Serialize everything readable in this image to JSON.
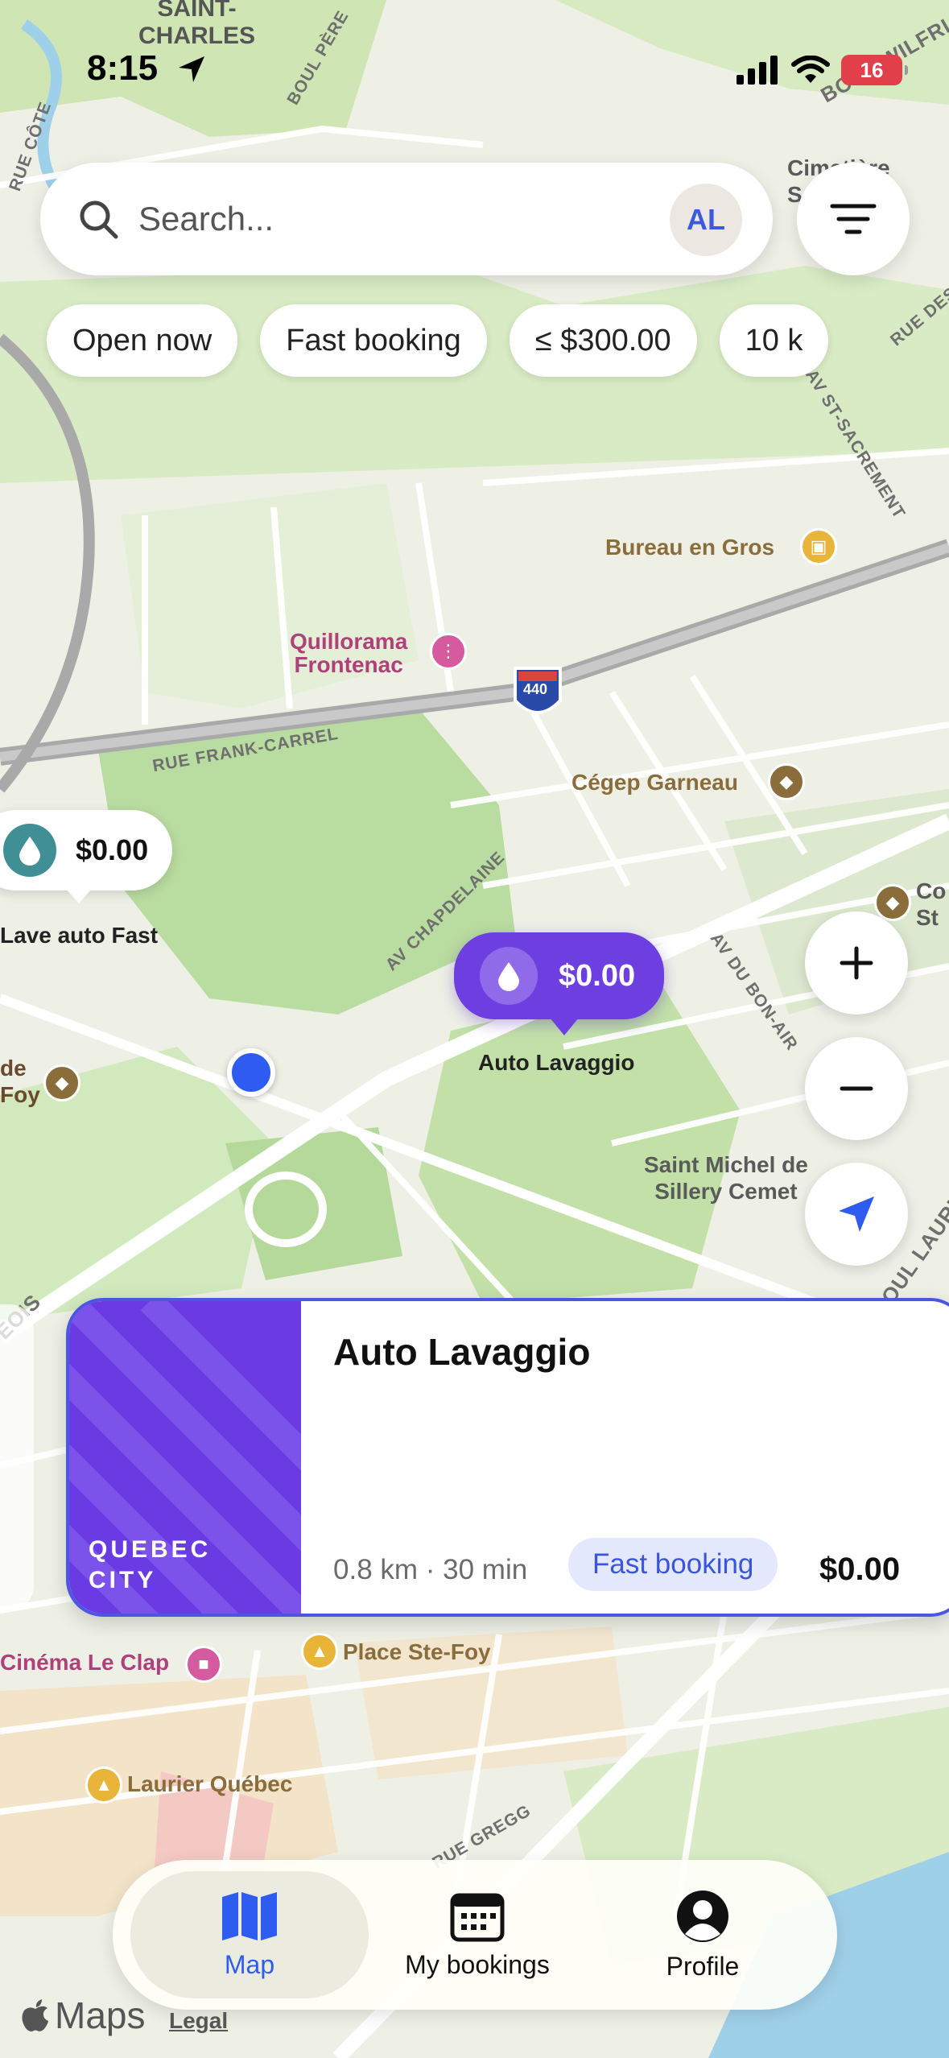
{
  "status_bar": {
    "time": "8:15",
    "battery": "16"
  },
  "search": {
    "placeholder": "Search...",
    "avatar_initials": "AL"
  },
  "filters": [
    "Open now",
    "Fast booking",
    "≤ $300.00",
    "10 k"
  ],
  "map": {
    "places": {
      "saint_charles": "SAINT-\nCHARLES",
      "bureau_en_gros": "Bureau en Gros",
      "quillorama": "Quillorama\nFrontenac",
      "cegep_garneau": "Cégep Garneau",
      "cinema": "Cinéma Le Clap",
      "place_ste_foy": "Place Ste-Foy",
      "laurier": "Laurier Québec",
      "saint_michel": "Saint Michel de\nSillery Cemet",
      "cimetiere": "Cimetière\nSaint-",
      "de_foy": "de\nFoy",
      "co_st": "Co\nSt"
    },
    "streets": {
      "boul_pere": "BOUL PÈRE",
      "rue_cote": "RUE CÔTE",
      "boul_wilfrid": "BOUL WILFRI",
      "rue_des_arts": "RUE DES ARTS",
      "av_st_sacrement": "AV ST-SACREMENT",
      "rue_frank_carrel": "RUE FRANK-CARREL",
      "av_chapdelaine": "AV CHAPDELAINE",
      "av_du_bon_air": "AV DU BON-AIR",
      "boul_laurier": "BOUL LAURIE",
      "rue_gregg": "RUE GREGG",
      "eois": "EOIS",
      "highway": "440"
    },
    "markers": [
      {
        "price": "$0.00",
        "name": "Lave auto Fast",
        "color": "#3f8f95"
      },
      {
        "price": "$0.00",
        "name": "Auto Lavaggio",
        "color": "#6d3ee0",
        "selected": true
      }
    ]
  },
  "controls": {
    "zoom_in": "+",
    "zoom_out": "−"
  },
  "card": {
    "title": "Auto Lavaggio",
    "city": "QUEBEC\nCITY",
    "meta": "0.8 km · 30 min",
    "badge": "Fast booking",
    "price": "$0.00",
    "accent": "#4a57e0"
  },
  "tabs": [
    {
      "label": "Map",
      "icon": "map-icon",
      "active": true
    },
    {
      "label": "My bookings",
      "icon": "calendar-icon",
      "active": false
    },
    {
      "label": "Profile",
      "icon": "profile-icon",
      "active": false
    }
  ],
  "footer": {
    "maps": "Maps",
    "legal": "Legal"
  },
  "colors": {
    "primary": "#2f5cf0",
    "marker_purple": "#6d3ee0",
    "marker_teal": "#3f8f95",
    "map_green": "#cfe6b4"
  }
}
